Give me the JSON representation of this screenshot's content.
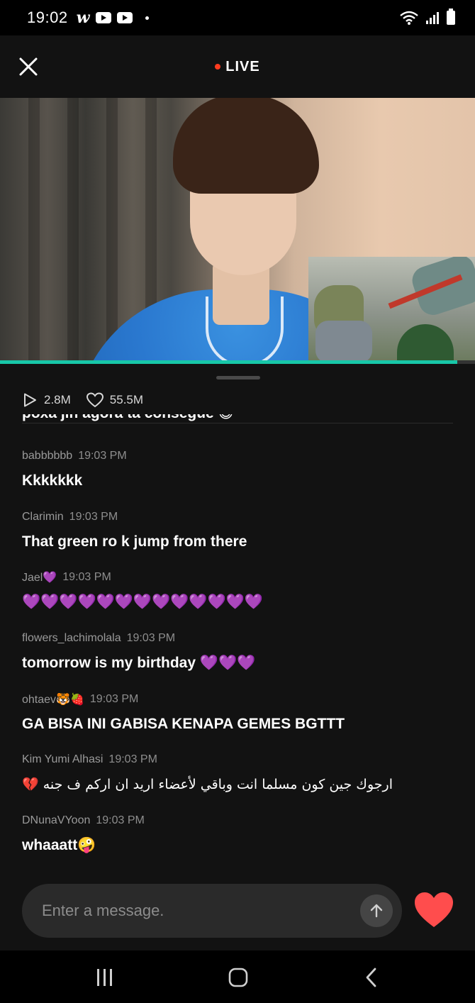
{
  "status_bar": {
    "time": "19:02",
    "app_icon": "w",
    "notification_icons": [
      "youtube-icon",
      "youtube-icon"
    ]
  },
  "header": {
    "live_label": "LIVE",
    "close_icon": "close-icon"
  },
  "video": {
    "progress_fraction": 0.963
  },
  "stats": {
    "views": "2.8M",
    "likes": "55.5M"
  },
  "chat": {
    "clipped_text": "poxa jin agora ta consegue 😅",
    "messages": [
      {
        "user": "babbbbbb",
        "time": "19:03 PM",
        "text": "Kkkkkkk"
      },
      {
        "user": "Clarimin",
        "time": "19:03 PM",
        "text": "That green ro k jump from there"
      },
      {
        "user": "Jael💜",
        "time": "19:03 PM",
        "text": "💜💜💜💜💜💜💜💜💜💜💜💜💜"
      },
      {
        "user": "flowers_lachimolala",
        "time": "19:03 PM",
        "text": "tomorrow is my birthday 💜💜💜"
      },
      {
        "user": "ohtaev🐯🍓",
        "time": "19:03 PM",
        "text": "GA BISA INI GABISA KENAPA GEMES BGTTT"
      },
      {
        "user": "Kim Yumi Alhasi",
        "time": "19:03 PM",
        "text": "ارجوك جين كون مسلما انت وباقي لأعضاء اريد ان اركم ف جنه 💔"
      },
      {
        "user": "DNunaVYoon",
        "time": "19:03 PM",
        "text": "whaaatt🤪"
      }
    ]
  },
  "composer": {
    "placeholder": "Enter a message."
  },
  "colors": {
    "accent_live": "#ff3b1f",
    "progress": "#18c7a8",
    "heart": "#ff4d4d"
  }
}
